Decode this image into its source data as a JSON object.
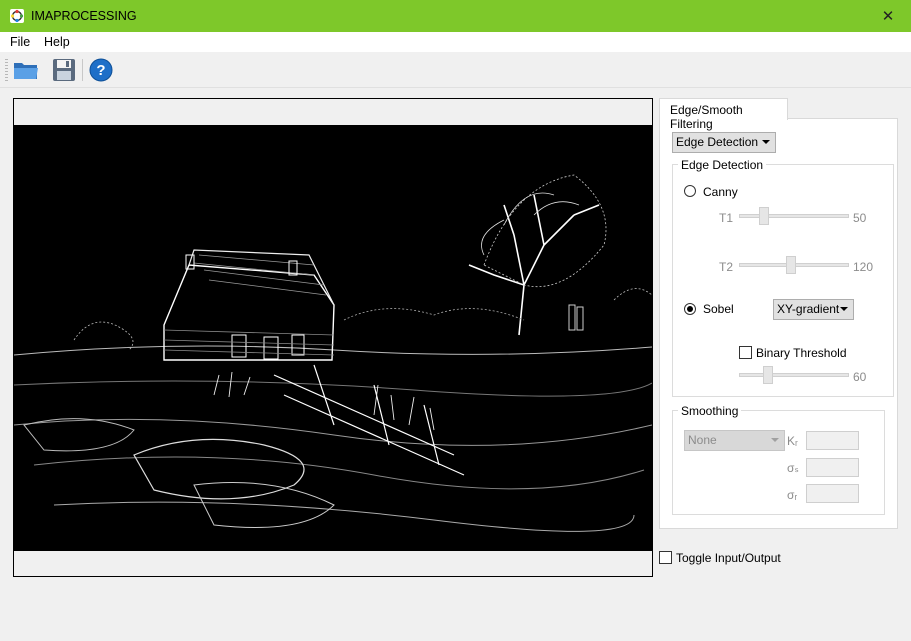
{
  "window": {
    "title": "IMAPROCESSING",
    "close_glyph": "✕"
  },
  "menu": {
    "file": "File",
    "help": "Help"
  },
  "toolbar": {
    "open_icon": "folder-open-icon",
    "save_icon": "save-icon",
    "help_icon": "help-icon",
    "help_glyph": "?"
  },
  "tabs": {
    "active": "Edge/Smooth Filtering"
  },
  "filter": {
    "mode": "Edge Detection"
  },
  "edge": {
    "group_title": "Edge Detection",
    "canny_label": "Canny",
    "canny_selected": false,
    "t1_label": "T1",
    "t1_value": "50",
    "t2_label": "T2",
    "t2_value": "120",
    "sobel_label": "Sobel",
    "sobel_selected": true,
    "sobel_mode": "XY-gradient",
    "binary_threshold_label": "Binary Threshold",
    "binary_threshold_checked": false,
    "threshold_value": "60"
  },
  "smoothing": {
    "group_title": "Smoothing",
    "type": "None",
    "kr_label": "Kᵣ",
    "sigma_s_label": "σₛ",
    "sigma_r_label": "σᵣ"
  },
  "toggle": {
    "label": "Toggle Input/Output",
    "checked": false
  },
  "colors": {
    "titlebar": "#7ec82a",
    "help_blue": "#1e6fc8",
    "image_bg": "#000000"
  }
}
